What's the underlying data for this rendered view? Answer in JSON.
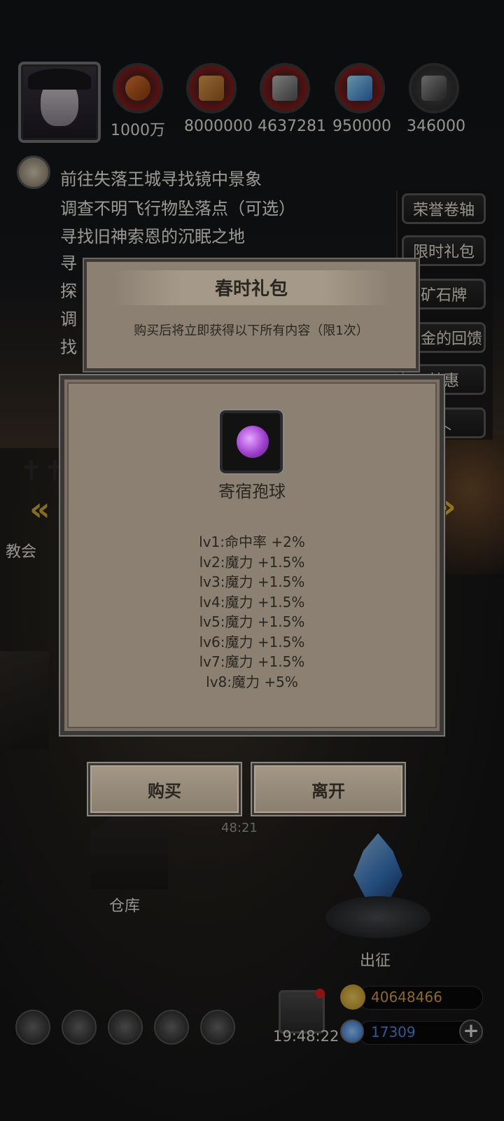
{
  "resources": [
    {
      "icon": "meat-icon",
      "value": "1000万"
    },
    {
      "icon": "wood-icon",
      "value": "8000000"
    },
    {
      "icon": "iron-icon",
      "value": "4637281"
    },
    {
      "icon": "crystal-icon",
      "value": "950000"
    },
    {
      "icon": "ore-icon",
      "value": "346000"
    }
  ],
  "quests": [
    "前往失落王城寻找镜中景象",
    "调查不明飞行物坠落点（可选）",
    "寻找旧神索恩的沉眠之地",
    "寻",
    "探",
    "调",
    "找"
  ],
  "side_menu": [
    "荣誉卷轴",
    "限时礼包",
    "矿石牌",
    "握金的回馈",
    "特惠"
  ],
  "map_labels": {
    "church": "教会",
    "warehouse": "仓库",
    "expedition": "出征"
  },
  "bg_timer": "48:21",
  "pack_dialog": {
    "title": "春时礼包",
    "subtitle": "购买后将立即获得以下所有内容（限1次）"
  },
  "item_dialog": {
    "item_name": "寄宿孢球",
    "stats": [
      "lv1:命中率 +2%",
      "lv2:魔力 +1.5%",
      "lv3:魔力 +1.5%",
      "lv4:魔力 +1.5%",
      "lv5:魔力 +1.5%",
      "lv6:魔力 +1.5%",
      "lv7:魔力 +1.5%",
      "lv8:魔力 +5%"
    ]
  },
  "buttons": {
    "buy": "购买",
    "leave": "离开"
  },
  "bottom_bar": {
    "clock": "19:48:22",
    "gold": "40648466",
    "gems": "17309",
    "gold_color": "#d9a040",
    "gems_color": "#4a8ae0"
  }
}
